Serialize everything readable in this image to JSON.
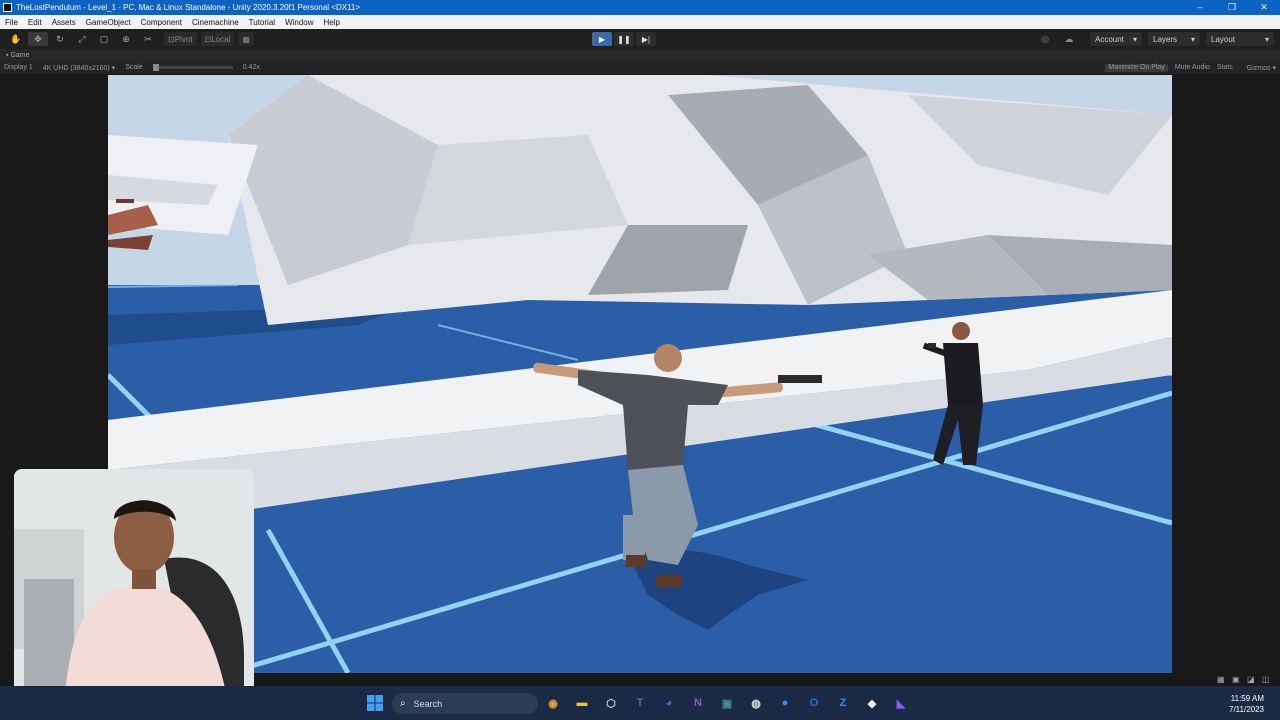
{
  "window": {
    "title": "TheLostPendulum - Level_1 - PC, Mac & Linux Standalone - Unity 2020.3.20f1 Personal <DX11>",
    "controls": [
      "–",
      "❐",
      "✕"
    ]
  },
  "menu": [
    "File",
    "Edit",
    "Assets",
    "GameObject",
    "Component",
    "Cinemachine",
    "Tutorial",
    "Window",
    "Help"
  ],
  "toolbar": {
    "tools": [
      "hand-icon",
      "move-icon",
      "rotate-icon",
      "scale-icon",
      "rect-icon",
      "transform-icon",
      "custom-tool-icon"
    ],
    "pivot_label": "Pivot",
    "local_label": "Local",
    "account_label": "Account",
    "layers_label": "Layers",
    "layout_label": "Layout"
  },
  "tab": {
    "label": "Game"
  },
  "game_toolbar": {
    "display": "Display 1",
    "resolution": "4K UHD (3840x2160)",
    "scale_label": "Scale",
    "scale_value": "0.42x",
    "maximize": "Maximize On Play",
    "mute": "Mute Audio",
    "stats": "Stats",
    "gizmos": "Gizmos"
  },
  "taskbar": {
    "search_placeholder": "Search",
    "apps": [
      {
        "icon": "chrome-icon",
        "glyph": "◉",
        "color": "#e8a33d"
      },
      {
        "icon": "file-explorer-icon",
        "glyph": "▬",
        "color": "#f1c232"
      },
      {
        "icon": "unity-hub-icon",
        "glyph": "⬡",
        "color": "#c9c9c9"
      },
      {
        "icon": "teams-icon",
        "glyph": "T",
        "color": "#5b5fc7"
      },
      {
        "icon": "discord-icon",
        "glyph": "◕",
        "color": "#5865f2"
      },
      {
        "icon": "visual-studio-icon",
        "glyph": "N",
        "color": "#8661c5"
      },
      {
        "icon": "terminal-icon",
        "glyph": "▣",
        "color": "#4a8a8a"
      },
      {
        "icon": "obs-icon",
        "glyph": "◍",
        "color": "#dddddd"
      },
      {
        "icon": "maps-icon",
        "glyph": "●",
        "color": "#3a8ee6"
      },
      {
        "icon": "outlook-icon",
        "glyph": "O",
        "color": "#1f6fd1"
      },
      {
        "icon": "zoom-icon",
        "glyph": "Z",
        "color": "#2d8cff"
      },
      {
        "icon": "unity-icon",
        "glyph": "◆",
        "color": "#eeeeee"
      },
      {
        "icon": "visual-studio-2-icon",
        "glyph": "◣",
        "color": "#8b5cf6"
      }
    ],
    "time": "11:59 AM",
    "date": "7/11/2023"
  },
  "colors": {
    "titlebar": "#0c63c4",
    "floor_blue": "#2a5ea6",
    "floor_lines": "#8fd3f5",
    "wall_white": "#e8eaee"
  }
}
